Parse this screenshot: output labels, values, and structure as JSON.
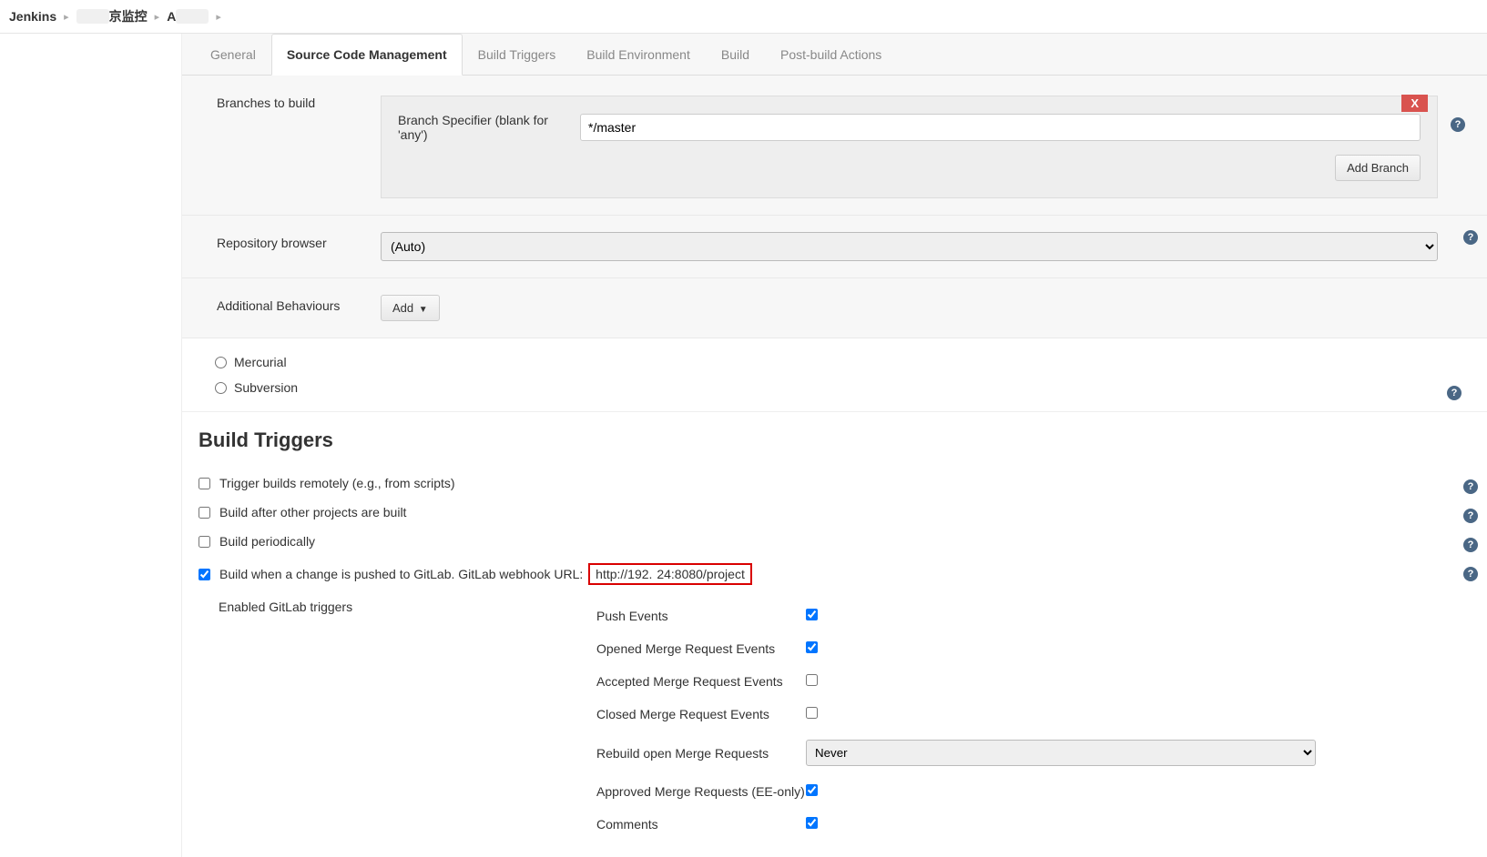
{
  "breadcrumb": {
    "root": "Jenkins",
    "mid_prefix": "",
    "mid_suffix": "京监控",
    "leaf_prefix": "A",
    "leaf_suffix": ""
  },
  "tabs": [
    "General",
    "Source Code Management",
    "Build Triggers",
    "Build Environment",
    "Build",
    "Post-build Actions"
  ],
  "active_tab": 1,
  "scm": {
    "branches_label": "Branches to build",
    "branch_spec_label": "Branch Specifier (blank for 'any')",
    "branch_spec_value": "*/master",
    "add_branch_btn": "Add Branch",
    "delete_btn": "X",
    "repo_browser_label": "Repository browser",
    "repo_browser_value": "(Auto)",
    "additional_label": "Additional Behaviours",
    "add_btn": "Add",
    "radios": {
      "mercurial": "Mercurial",
      "subversion": "Subversion"
    }
  },
  "bt": {
    "heading": "Build Triggers",
    "remote": "Trigger builds remotely (e.g., from scripts)",
    "after": "Build after other projects are built",
    "periodic": "Build periodically",
    "gitlab_pre": "Build when a change is pushed to GitLab. GitLab webhook URL:",
    "gitlab_url_left": "http://192.",
    "gitlab_url_mid": "      ",
    "gitlab_url_right": "24:8080/project",
    "gitlab_url_tail": "   ",
    "enabled_label": "Enabled GitLab triggers",
    "triggers": {
      "push": "Push Events",
      "opened_mr": "Opened Merge Request Events",
      "accepted_mr": "Accepted Merge Request Events",
      "closed_mr": "Closed Merge Request Events",
      "rebuild": "Rebuild open Merge Requests",
      "rebuild_value": "Never",
      "approved": "Approved Merge Requests (EE-only)",
      "comments": "Comments"
    }
  }
}
